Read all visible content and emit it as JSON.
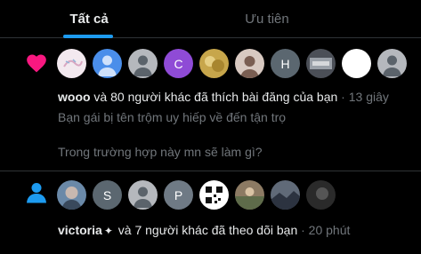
{
  "tabs": [
    {
      "label": "Tất cả",
      "active": true
    },
    {
      "label": "Ưu tiên",
      "active": false
    }
  ],
  "notifications": [
    {
      "icon": "heart-icon",
      "icon_color": "#f91880",
      "avatars": [
        {
          "kind": "image",
          "bg": "#f3e9ef",
          "icon": "sketch-image"
        },
        {
          "kind": "default",
          "bg": "#4a8eea",
          "icon": "default-avatar-icon"
        },
        {
          "kind": "default",
          "bg": "#b5b8bd",
          "icon": "default-avatar-icon"
        },
        {
          "kind": "letter",
          "bg": "#8f4bd6",
          "letter": "C"
        },
        {
          "kind": "image",
          "bg": "#c7a64b",
          "icon": "photo-image"
        },
        {
          "kind": "default",
          "bg": "#d8c9c1",
          "icon": "default-avatar-icon"
        },
        {
          "kind": "letter",
          "bg": "#5b6770",
          "letter": "H"
        },
        {
          "kind": "image",
          "bg": "#4b4f57",
          "icon": "photo-image"
        },
        {
          "kind": "blank",
          "bg": "#ffffff"
        },
        {
          "kind": "default",
          "bg": "#b5b8bd",
          "icon": "default-avatar-icon"
        }
      ],
      "actor": "wooo",
      "action": " và 80 người khác đã thích bài đăng của bạn",
      "time": " · 13 giây",
      "excerpt_line1": "Bạn gái bị tên trộm uy hiếp về đến tận trọ",
      "excerpt_line2": "Trong trường hợp này mn sẽ làm gì?"
    },
    {
      "icon": "follow-person-icon",
      "icon_color": "#1d9bf0",
      "avatars": [
        {
          "kind": "image",
          "bg": "#6a89a8",
          "icon": "photo-image"
        },
        {
          "kind": "letter",
          "bg": "#5b6770",
          "letter": "S"
        },
        {
          "kind": "default",
          "bg": "#b5b8bd",
          "icon": "default-avatar-icon"
        },
        {
          "kind": "letter",
          "bg": "#6f7a85",
          "letter": "P"
        },
        {
          "kind": "image",
          "bg": "#ffffff",
          "icon": "qr-image"
        },
        {
          "kind": "image",
          "bg": "#8c7a63",
          "icon": "photo-image"
        },
        {
          "kind": "image",
          "bg": "#606a78",
          "icon": "photo-image"
        },
        {
          "kind": "image",
          "bg": "#2a2a2a",
          "icon": "photo-image"
        }
      ],
      "actor": "victoria",
      "verified_glyph": "✦",
      "action": " và 7 người khác đã theo dõi bạn",
      "time": " · 20 phút"
    }
  ]
}
